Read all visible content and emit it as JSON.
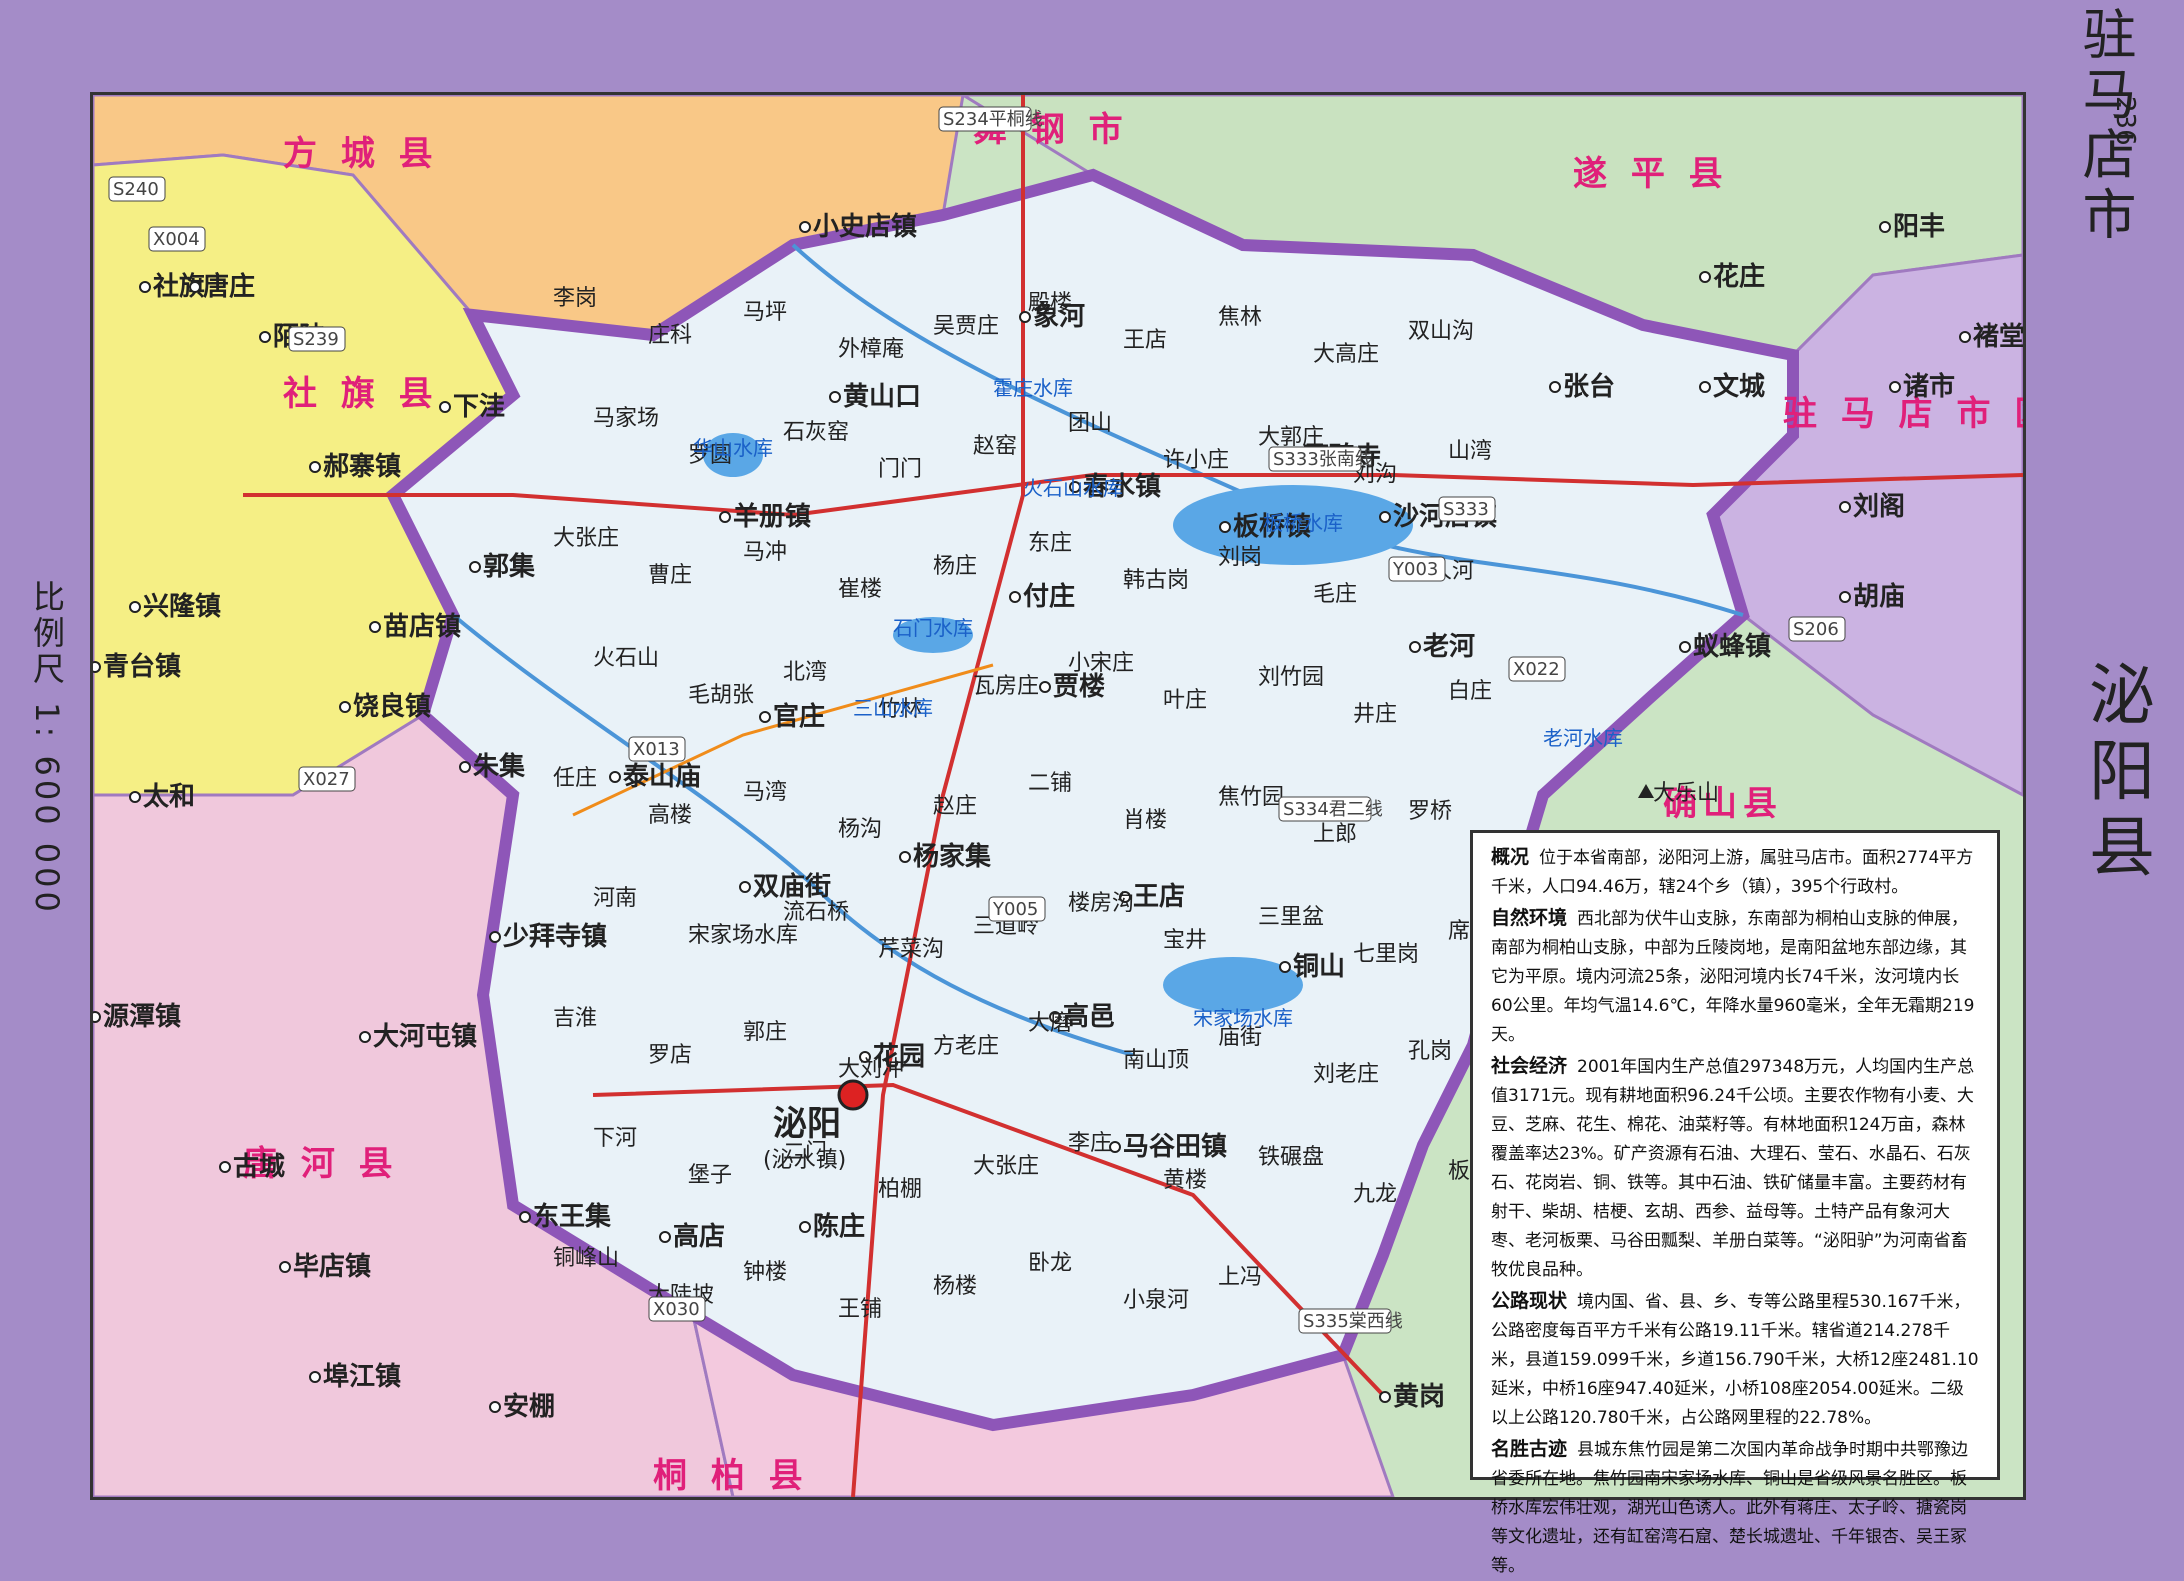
{
  "page": {
    "city_title": "驻马店市",
    "county_title": "泌阳县",
    "page_number": "236",
    "scale": "比例尺  1: 600 000"
  },
  "colors": {
    "county_fill": "#e9f2f8",
    "county_border": "#8e56b8",
    "fangcheng_fill": "#f9c887",
    "sheqi_fill": "#f5ef85",
    "tanghe_fill": "#f0c8dc",
    "suiping_fill": "#c9e2c0",
    "zhumadian_fill": "#cbb3e2",
    "tongbai_fill": "#f3c9de",
    "water": "#5aa7e6",
    "road_national": "#f08c1a",
    "road_provincial": "#d23030"
  },
  "legend_icons": [
    "town-dot-icon",
    "county-seat-icon",
    "reservoir-icon",
    "mountain-peak-icon"
  ],
  "neighbors": [
    {
      "id": "fangcheng",
      "label": "方  城  县"
    },
    {
      "id": "wugang",
      "label": "舞  钢  市"
    },
    {
      "id": "suiping",
      "label": "遂  平  县"
    },
    {
      "id": "sheqi",
      "label": "社  旗  县"
    },
    {
      "id": "zhumadian",
      "label": "驻 马 店 市 区"
    },
    {
      "id": "queshan",
      "label": "确山县"
    },
    {
      "id": "tanghe",
      "label": "唐  河  县"
    },
    {
      "id": "tongbai",
      "label": "桐  柏  县"
    }
  ],
  "county_seat": {
    "name": "泌阳",
    "sub": "(泌水镇)"
  },
  "towns": [
    {
      "name": "小史店镇"
    },
    {
      "name": "象河"
    },
    {
      "name": "黄山口"
    },
    {
      "name": "春水镇"
    },
    {
      "name": "下碑寺"
    },
    {
      "name": "板桥镇"
    },
    {
      "name": "沙河店镇"
    },
    {
      "name": "羊册镇"
    },
    {
      "name": "郭集"
    },
    {
      "name": "付庄"
    },
    {
      "name": "老河"
    },
    {
      "name": "贾楼"
    },
    {
      "name": "官庄"
    },
    {
      "name": "泰山庙"
    },
    {
      "name": "杨家集"
    },
    {
      "name": "双庙街"
    },
    {
      "name": "王店"
    },
    {
      "name": "铜山"
    },
    {
      "name": "高邑"
    },
    {
      "name": "花园"
    },
    {
      "name": "马谷田镇"
    },
    {
      "name": "陈庄"
    },
    {
      "name": "高店"
    },
    {
      "name": "黄岗"
    },
    {
      "name": "社旗"
    },
    {
      "name": "郝寨镇"
    },
    {
      "name": "苗店镇"
    },
    {
      "name": "饶良镇"
    },
    {
      "name": "太和"
    },
    {
      "name": "朱集"
    },
    {
      "name": "少拜寺镇"
    },
    {
      "name": "大河屯镇"
    },
    {
      "name": "源潭镇"
    },
    {
      "name": "古城"
    },
    {
      "name": "毕店镇"
    },
    {
      "name": "东王集"
    },
    {
      "name": "埠江镇"
    },
    {
      "name": "安棚"
    },
    {
      "name": "蚁蜂镇"
    },
    {
      "name": "刘阁"
    },
    {
      "name": "胡庙"
    },
    {
      "name": "阳丰"
    },
    {
      "name": "花庄"
    },
    {
      "name": "文城"
    },
    {
      "name": "张台"
    },
    {
      "name": "褚堂"
    },
    {
      "name": "诸市"
    },
    {
      "name": "兴隆镇"
    },
    {
      "name": "青台镇"
    },
    {
      "name": "陌陂"
    },
    {
      "name": "下洼"
    },
    {
      "name": "唐庄"
    }
  ],
  "places": [
    {
      "name": "李岗"
    },
    {
      "name": "庄科"
    },
    {
      "name": "马坪"
    },
    {
      "name": "外樟庵"
    },
    {
      "name": "吴贾庄"
    },
    {
      "name": "殿楼"
    },
    {
      "name": "王店"
    },
    {
      "name": "焦林"
    },
    {
      "name": "大高庄"
    },
    {
      "name": "双山沟"
    },
    {
      "name": "马家场"
    },
    {
      "name": "罗圆"
    },
    {
      "name": "石灰窑"
    },
    {
      "name": "门门"
    },
    {
      "name": "赵窑"
    },
    {
      "name": "团山"
    },
    {
      "name": "许小庄"
    },
    {
      "name": "大郭庄"
    },
    {
      "name": "刘沟"
    },
    {
      "name": "山湾"
    },
    {
      "name": "大张庄"
    },
    {
      "name": "曹庄"
    },
    {
      "name": "马冲"
    },
    {
      "name": "崔楼"
    },
    {
      "name": "杨庄"
    },
    {
      "name": "东庄"
    },
    {
      "name": "韩古岗"
    },
    {
      "name": "刘岗"
    },
    {
      "name": "毛庄"
    },
    {
      "name": "石人河"
    },
    {
      "name": "火石山"
    },
    {
      "name": "毛胡张"
    },
    {
      "name": "北湾"
    },
    {
      "name": "竹林"
    },
    {
      "name": "瓦房庄"
    },
    {
      "name": "小宋庄"
    },
    {
      "name": "叶庄"
    },
    {
      "name": "刘竹园"
    },
    {
      "name": "井庄"
    },
    {
      "name": "白庄"
    },
    {
      "name": "任庄"
    },
    {
      "name": "高楼"
    },
    {
      "name": "马湾"
    },
    {
      "name": "杨沟"
    },
    {
      "name": "赵庄"
    },
    {
      "name": "二铺"
    },
    {
      "name": "肖楼"
    },
    {
      "name": "焦竹园"
    },
    {
      "name": "上郎"
    },
    {
      "name": "罗桥"
    },
    {
      "name": "河南"
    },
    {
      "name": "宋家场水库"
    },
    {
      "name": "流石桥"
    },
    {
      "name": "芹菜沟"
    },
    {
      "name": "三道岭"
    },
    {
      "name": "楼房沟"
    },
    {
      "name": "宝井"
    },
    {
      "name": "三里盆"
    },
    {
      "name": "七里岗"
    },
    {
      "name": "席岗"
    },
    {
      "name": "吉淮"
    },
    {
      "name": "罗店"
    },
    {
      "name": "郭庄"
    },
    {
      "name": "大刘冲"
    },
    {
      "name": "方老庄"
    },
    {
      "name": "大磨"
    },
    {
      "name": "南山顶"
    },
    {
      "name": "庙街"
    },
    {
      "name": "刘老庄"
    },
    {
      "name": "孔岗"
    },
    {
      "name": "下河"
    },
    {
      "name": "堡子"
    },
    {
      "name": "二门"
    },
    {
      "name": "柏棚"
    },
    {
      "name": "大张庄"
    },
    {
      "name": "李庄"
    },
    {
      "name": "黄楼"
    },
    {
      "name": "铁碾盘"
    },
    {
      "name": "九龙"
    },
    {
      "name": "板桥水库"
    },
    {
      "name": "铜峰山"
    },
    {
      "name": "大陡坡"
    },
    {
      "name": "钟楼"
    },
    {
      "name": "王铺"
    },
    {
      "name": "杨楼"
    },
    {
      "name": "卧龙"
    },
    {
      "name": "小泉河"
    },
    {
      "name": "上冯"
    }
  ],
  "roads": [
    {
      "code": "S234平桐线"
    },
    {
      "code": "S333张南线"
    },
    {
      "code": "S334君二线"
    },
    {
      "code": "S335棠西线"
    },
    {
      "code": "S333"
    },
    {
      "code": "S206"
    },
    {
      "code": "X022"
    },
    {
      "code": "X030"
    },
    {
      "code": "Y005"
    },
    {
      "code": "X013"
    },
    {
      "code": "X004"
    },
    {
      "code": "X027"
    },
    {
      "code": "Y003"
    },
    {
      "code": "S239"
    },
    {
      "code": "S240"
    }
  ],
  "waters": [
    {
      "name": "华山水库"
    },
    {
      "name": "石门水库"
    },
    {
      "name": "三山水库"
    },
    {
      "name": "火石山水库"
    },
    {
      "name": "板桥水库"
    },
    {
      "name": "宋家场水库"
    },
    {
      "name": "老河水库"
    },
    {
      "name": "霍庄水库"
    }
  ],
  "peak": {
    "name": "大乐山"
  },
  "info": {
    "title": "概况",
    "sections": [
      {
        "head": "概况",
        "body": "位于本省南部，泌阳河上游，属驻马店市。面积2774平方千米，人口94.46万，辖24个乡（镇），395个行政村。"
      },
      {
        "head": "自然环境",
        "body": "西北部为伏牛山支脉，东南部为桐柏山支脉的伸展，南部为桐柏山支脉，中部为丘陵岗地，是南阳盆地东部边缘，其它为平原。境内河流25条，泌阳河境内长74千米，汝河境内长60公里。年均气温14.6℃，年降水量960毫米，全年无霜期219天。"
      },
      {
        "head": "社会经济",
        "body": "2001年国内生产总值297348万元，人均国内生产总值3171元。现有耕地面积96.24千公顷。主要农作物有小麦、大豆、芝麻、花生、棉花、油菜籽等。有林地面积124万亩，森林覆盖率达23%。矿产资源有石油、大理石、莹石、水晶石、石灰石、花岗岩、铜、铁等。其中石油、铁矿储量丰富。主要药材有射干、柴胡、桔梗、玄胡、西参、益母等。土特产品有象河大枣、老河板栗、马谷田瓢梨、羊册白菜等。“泌阳驴”为河南省畜牧优良品种。"
      },
      {
        "head": "公路现状",
        "body": "境内国、省、县、乡、专等公路里程530.167千米，公路密度每百平方千米有公路19.11千米。辖省道214.278千米，县道159.099千米，乡道156.790千米，大桥12座2481.10延米，中桥16座947.40延米，小桥108座2054.00延米。二级以上公路120.780千米，占公路网里程的22.78%。"
      },
      {
        "head": "名胜古迹",
        "body": "县城东焦竹园是第二次国内革命战争时期中共鄂豫边省委所在地。焦竹园南宋家场水库、铜山是省级风景名胜区。板桥水库宏伟壮观，湖光山色诱人。此外有蒋庄、太子岭、搪瓷岗等文化遗址，还有缸窑湾石窟、楚长城遗址、千年银杏、吴王冢等。"
      }
    ]
  }
}
